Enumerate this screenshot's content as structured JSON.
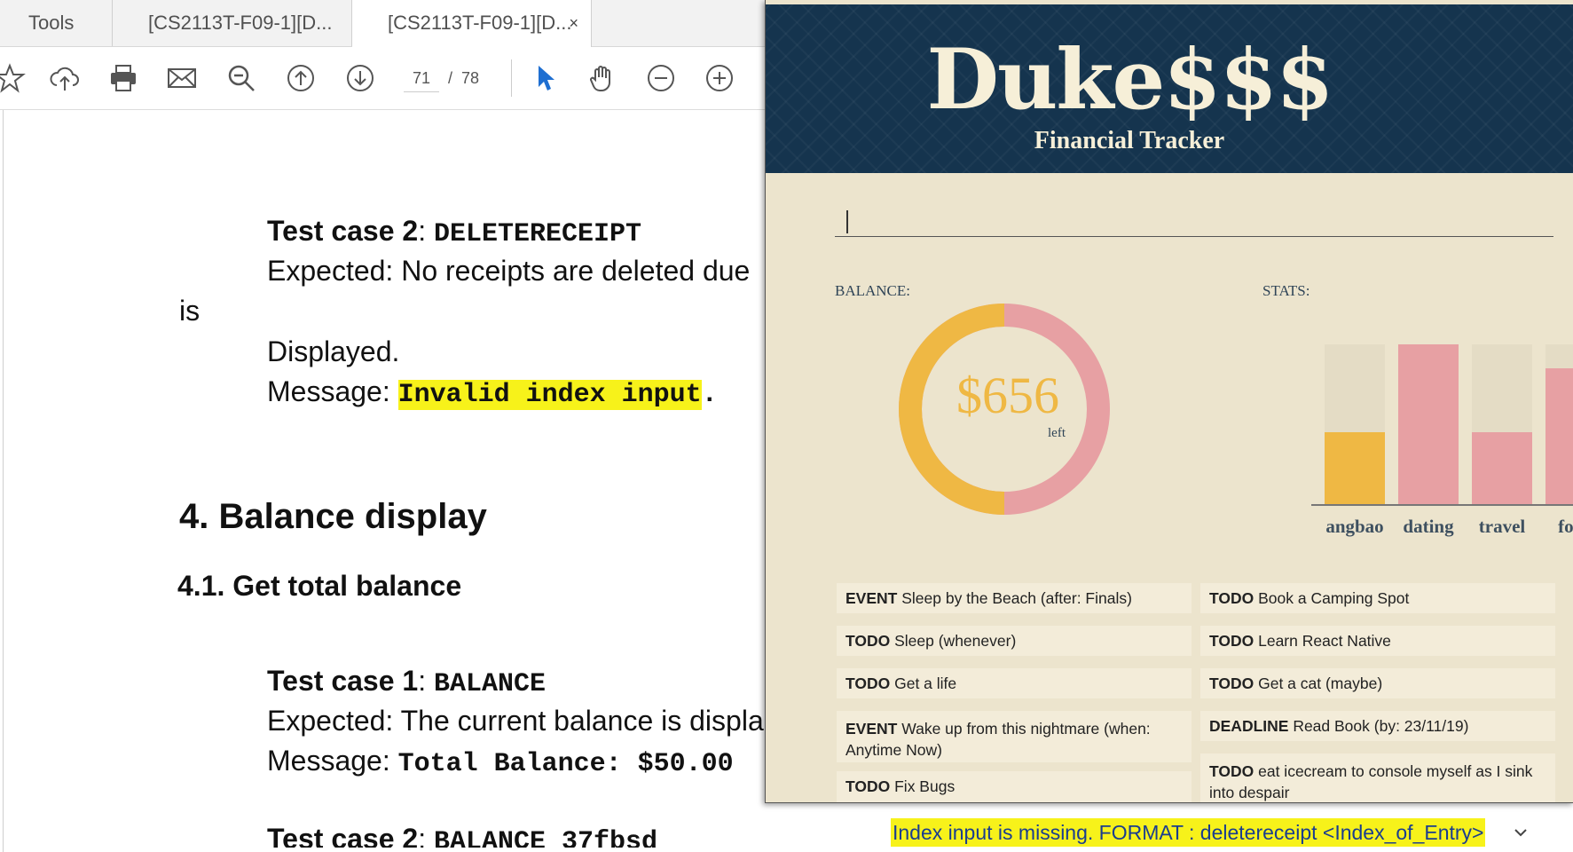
{
  "pdf": {
    "tabs": {
      "tools": "Tools",
      "tab1": "[CS2113T-F09-1][D...",
      "tab2": "[CS2113T-F09-1][D...",
      "close": "×"
    },
    "page": {
      "current": "71",
      "separator": "/",
      "total": "78"
    },
    "doc": {
      "tc2_label": "Test case 2",
      "tc2_colon": ": ",
      "tc2_cmd": "DELETERECEIPT",
      "expected1": "Expected: No receipts are deleted due",
      "is": "is",
      "displayed": "Displayed.",
      "message_label": "Message: ",
      "message_val": "Invalid index input",
      "message_dot": ".",
      "section4": "4. Balance display",
      "section41": "4.1. Get total balance",
      "tc1_label": "Test case 1",
      "tc1_colon": ": ",
      "tc1_cmd": "BALANCE",
      "expected2": "Expected: The current balance is displa",
      "message2_label": "Message: ",
      "message2_val": "Total Balance: $50.00",
      "tc2b_label": "Test case 2",
      "tc2b_colon": ": ",
      "tc2b_cmd": "BALANCE 37fbsd"
    }
  },
  "app": {
    "title": "Duke$$$",
    "subtitle": "Financial Tracker",
    "command_value": "",
    "balance_label": "BALANCE:",
    "balance_amount": "$656",
    "balance_suffix": "left",
    "balance_fraction_spent": 0.5,
    "stats_label": "STATS:",
    "colors": {
      "header": "#15344e",
      "background": "#ece4cd",
      "gold": "#efb844",
      "pink": "#e7a0a3",
      "bar_track": "#e4dcc5"
    },
    "chart_data": {
      "type": "bar",
      "categories": [
        "angbao",
        "dating",
        "travel",
        "food"
      ],
      "values": [
        0.45,
        1.0,
        0.45,
        0.85
      ],
      "ylim": [
        0,
        1
      ]
    },
    "tasks_left": [
      {
        "type": "EVENT",
        "text": "Sleep by the Beach (after: Finals)"
      },
      {
        "type": "TODO",
        "text": "Sleep (whenever)"
      },
      {
        "type": "TODO",
        "text": "Get a life"
      },
      {
        "type": "EVENT",
        "text": "Wake up from this nightmare (when: Anytime Now)"
      },
      {
        "type": "TODO",
        "text": "Fix Bugs"
      }
    ],
    "tasks_right": [
      {
        "type": "TODO",
        "text": "Book a Camping Spot"
      },
      {
        "type": "TODO",
        "text": "Learn React Native"
      },
      {
        "type": "TODO",
        "text": "Get a cat (maybe)"
      },
      {
        "type": "DEADLINE",
        "text": "Read Book (by: 23/11/19)"
      },
      {
        "type": "TODO",
        "text": "eat icecream to console myself as I sink into despair"
      }
    ]
  },
  "status_bar": {
    "message": "Index input is missing. FORMAT : deletereceipt <Index_of_Entry>"
  }
}
